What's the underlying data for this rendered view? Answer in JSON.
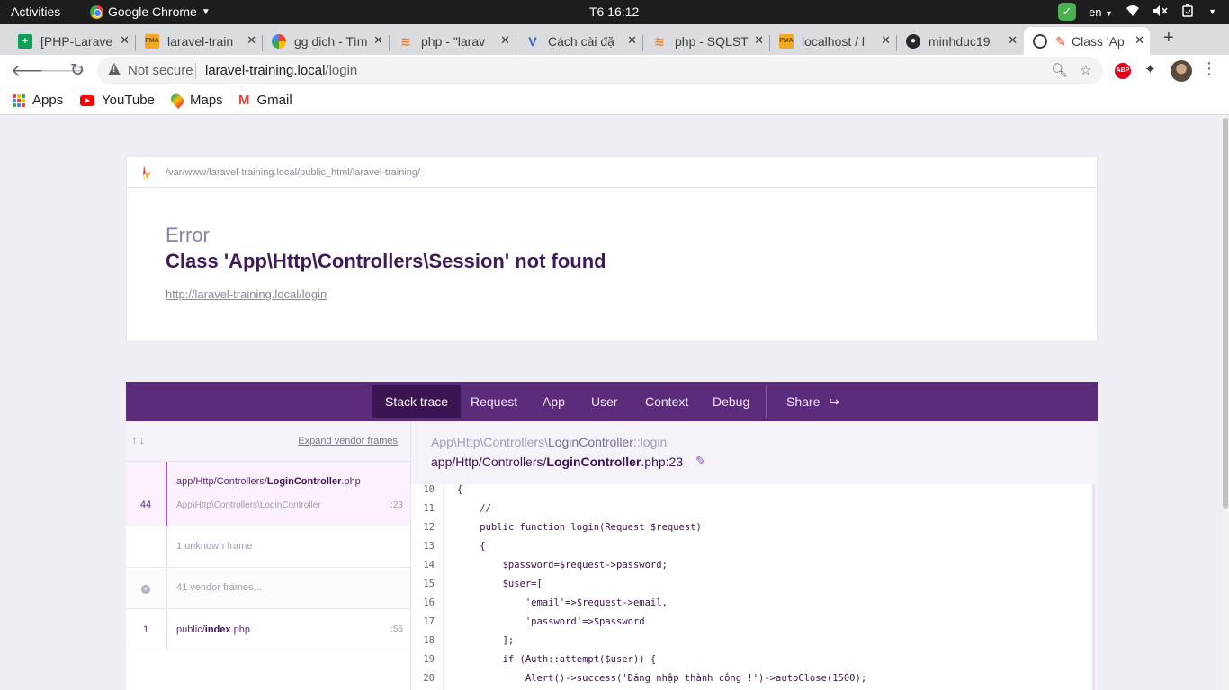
{
  "os": {
    "activities": "Activities",
    "app_name": "Google Chrome",
    "clock": "T6 16:12",
    "language": "en"
  },
  "tabs": [
    {
      "title": "[PHP-Larave",
      "icon": "sheets-icon"
    },
    {
      "title": "laravel-train",
      "icon": "phpmyadmin-icon"
    },
    {
      "title": "gg dich - Tìm",
      "icon": "google-icon"
    },
    {
      "title": "php - \"larav",
      "icon": "stackoverflow-icon"
    },
    {
      "title": "Cách cài đặ",
      "icon": "viblo-icon"
    },
    {
      "title": "php - SQLST",
      "icon": "stackoverflow-icon"
    },
    {
      "title": "localhost / l",
      "icon": "phpmyadmin-icon"
    },
    {
      "title": "minhduc19",
      "icon": "github-icon"
    },
    {
      "title": "Class 'Ap",
      "icon": "ignition-icon"
    }
  ],
  "toolbar": {
    "security_label": "Not secure",
    "url_host": "laravel-training.local",
    "url_path": "/login"
  },
  "bookmarks": [
    "Apps",
    "YouTube",
    "Maps",
    "Gmail"
  ],
  "error": {
    "path": "/var/www/laravel-training.local/public_html/laravel-training/",
    "type": "Error",
    "message": "Class 'App\\Http\\Controllers\\Session' not found",
    "url": "http://laravel-training.local/login"
  },
  "nav": {
    "items": [
      "Stack trace",
      "Request",
      "App",
      "User",
      "Context",
      "Debug"
    ],
    "share": "Share"
  },
  "frames_panel": {
    "expand_label": "Expand vendor frames",
    "frames": [
      {
        "num": "44",
        "file_prefix": "app/Http/Controllers/",
        "file_name": "LoginController",
        "file_ext": ".php",
        "class": "App\\Http\\Controllers\\LoginController",
        "line": ":23"
      },
      {
        "label": "1 unknown frame"
      },
      {
        "label": "41 vendor frames..."
      },
      {
        "num": "1",
        "file_prefix": "public/",
        "file_name": "index",
        "file_ext": ".php",
        "line": ":55"
      }
    ]
  },
  "code_panel": {
    "class_prefix": "App\\Http\\Controllers\\",
    "class_name": "LoginController",
    "method": "::login",
    "file_prefix": "app/Http/Controllers/",
    "file_name": "LoginController",
    "file_suffix": ".php:23",
    "lines": [
      {
        "n": "10",
        "code": "{"
      },
      {
        "n": "11",
        "code": "    //"
      },
      {
        "n": "12",
        "code": "    public function login(Request $request)"
      },
      {
        "n": "13",
        "code": "    {"
      },
      {
        "n": "14",
        "code": "        $password=$request->password;"
      },
      {
        "n": "15",
        "code": "        $user=["
      },
      {
        "n": "16",
        "code": "            'email'=>$request->email,"
      },
      {
        "n": "17",
        "code": "            'password'=>$password"
      },
      {
        "n": "18",
        "code": "        ];"
      },
      {
        "n": "19",
        "code": "        if (Auth::attempt($user)) {"
      },
      {
        "n": "20",
        "code": "            Alert()->success('Đăng nhập thành công !')->autoClose(1500);"
      }
    ]
  }
}
